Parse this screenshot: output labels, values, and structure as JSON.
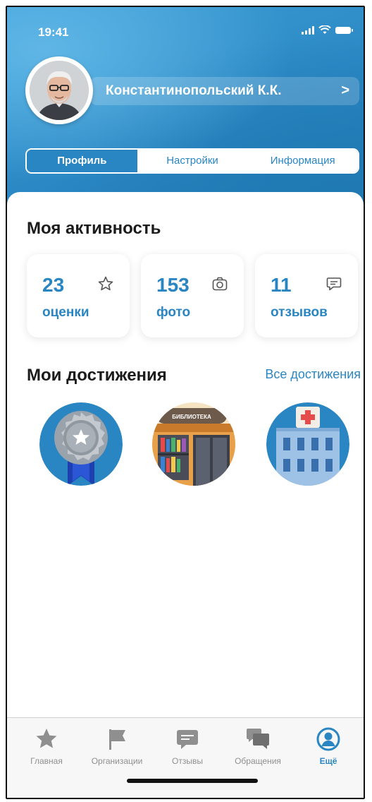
{
  "status": {
    "time": "19:41"
  },
  "profile": {
    "name": "Константинопольский К.К.",
    "chevron": ">"
  },
  "segments": [
    {
      "label": "Профиль"
    },
    {
      "label": "Настройки"
    },
    {
      "label": "Информация"
    }
  ],
  "activity": {
    "title": "Моя активность",
    "cards": [
      {
        "value": "23",
        "label": "оценки",
        "icon": "star-outline-icon"
      },
      {
        "value": "153",
        "label": "фото",
        "icon": "camera-icon"
      },
      {
        "value": "11",
        "label": "отзывов",
        "icon": "comment-icon"
      }
    ]
  },
  "achievements": {
    "title": "Мои достижения",
    "all_link": "Все достижения",
    "items": [
      {
        "icon": "medal-badge-icon"
      },
      {
        "icon": "library-badge-icon",
        "sign": "БИБЛИОТЕКА"
      },
      {
        "icon": "hospital-badge-icon"
      }
    ]
  },
  "tabbar": {
    "items": [
      {
        "label": "Главная",
        "icon": "star-icon"
      },
      {
        "label": "Организации",
        "icon": "flag-icon"
      },
      {
        "label": "Отзывы",
        "icon": "chat-bubble-icon"
      },
      {
        "label": "Обращения",
        "icon": "chat-bubbles-icon"
      },
      {
        "label": "Ещё",
        "icon": "user-circle-icon"
      }
    ],
    "active_index": 4
  },
  "colors": {
    "accent": "#2a86c2",
    "header_top": "#3d9ed6",
    "inactive": "#8f8f8f"
  }
}
